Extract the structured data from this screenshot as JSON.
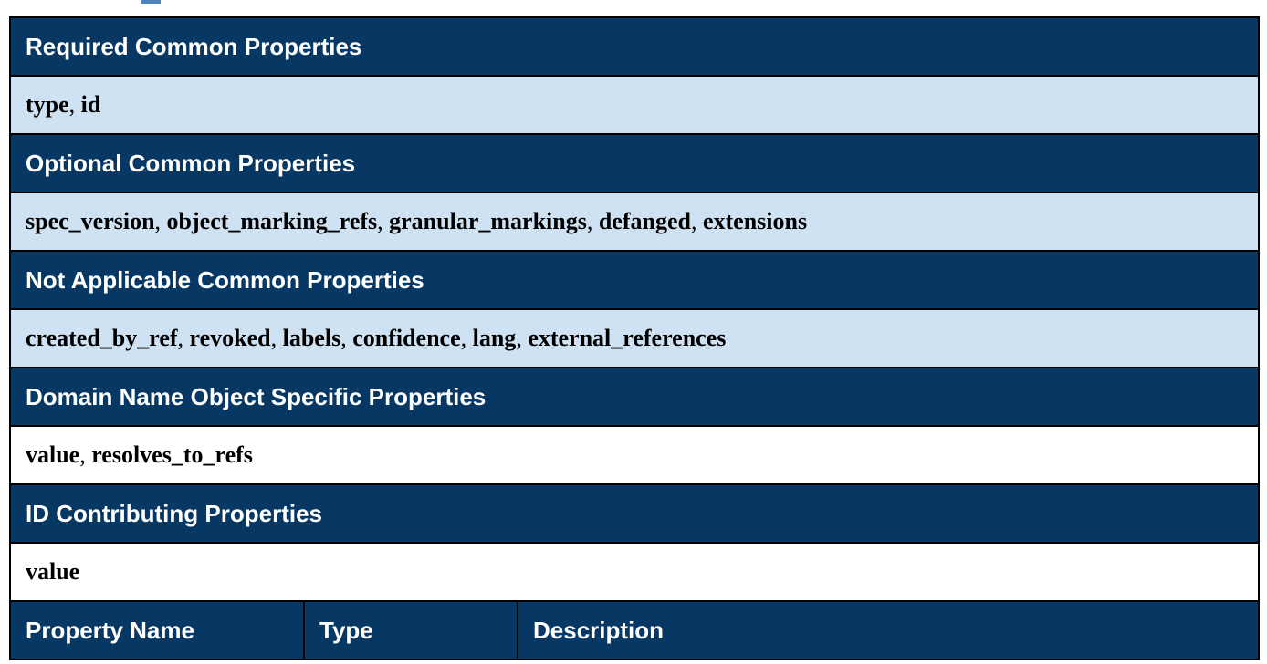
{
  "sections": [
    {
      "header": "Required Common Properties",
      "style": "light",
      "values": [
        "type",
        "id"
      ]
    },
    {
      "header": "Optional Common Properties",
      "style": "light",
      "values": [
        "spec_version",
        "object_marking_refs",
        "granular_markings",
        "defanged",
        "extensions"
      ]
    },
    {
      "header": "Not Applicable Common Properties",
      "style": "light",
      "values": [
        "created_by_ref",
        "revoked",
        "labels",
        "confidence",
        "lang",
        "external_references"
      ]
    },
    {
      "header": "Domain Name Object Specific Properties",
      "style": "white",
      "values": [
        "value",
        "resolves_to_refs"
      ]
    },
    {
      "header": "ID Contributing Properties",
      "style": "white",
      "values": [
        "value"
      ]
    }
  ],
  "columns": {
    "property_name": "Property Name",
    "type": "Type",
    "description": "Description"
  },
  "colors": {
    "header_bg": "#073763",
    "light_row_bg": "#cfe2f3",
    "accent": "#4f81bd"
  }
}
